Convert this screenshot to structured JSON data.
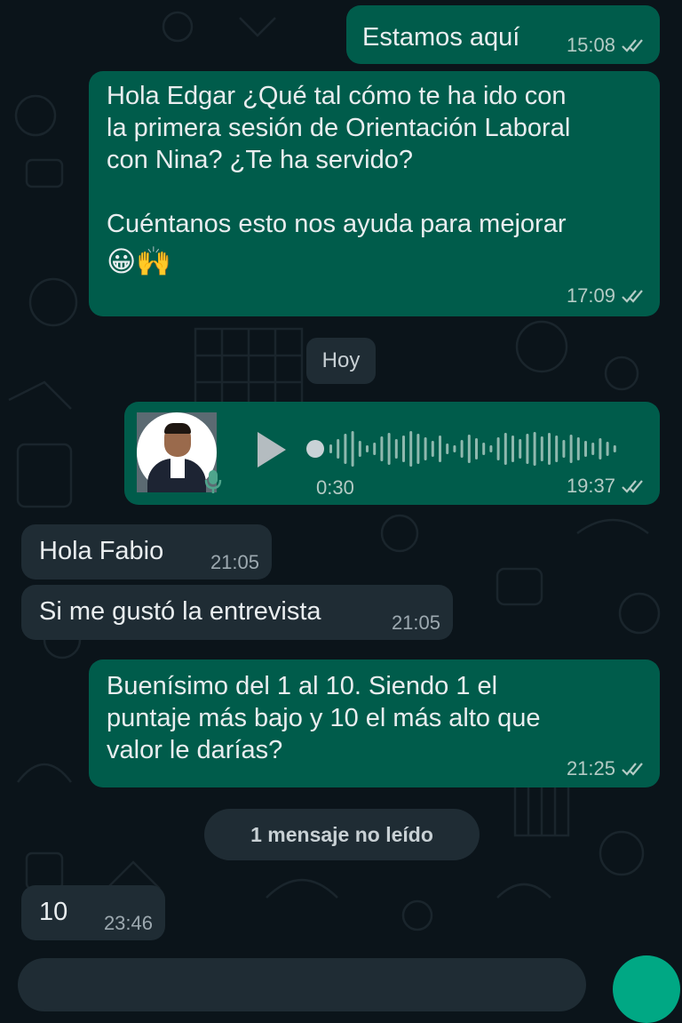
{
  "messages": {
    "m1": {
      "text": "Estamos aquí",
      "time": "15:08"
    },
    "m2": {
      "text": "Hola Edgar ¿Qué tal cómo te ha ido con\nla primera sesión de Orientación Laboral\ncon Nina? ¿Te ha servido?\n\nCuéntanos esto nos ayuda para mejorar",
      "emoji": "😀🙌",
      "time": "17:09"
    },
    "voice": {
      "duration": "0:30",
      "time": "19:37"
    },
    "m4": {
      "text": "Hola Fabio",
      "time": "21:05"
    },
    "m5": {
      "text": "Si me gustó la entrevista",
      "time": "21:05"
    },
    "m6": {
      "text": "Buenísimo del 1 al 10. Siendo 1 el\npuntaje más bajo y 10 el más alto que\nvalor le darías?",
      "time": "21:25"
    },
    "m7": {
      "text": "10",
      "time": "23:46"
    }
  },
  "date_chip": "Hoy",
  "unread_banner": "1 mensaje no leído",
  "colors": {
    "outgoing": "#005c4b",
    "incoming": "#1f2c34",
    "background": "#0b141a",
    "read_ticks": "#b4cbc5"
  },
  "icons": [
    "double-check-icon",
    "play-icon",
    "microphone-icon",
    "avatar"
  ]
}
